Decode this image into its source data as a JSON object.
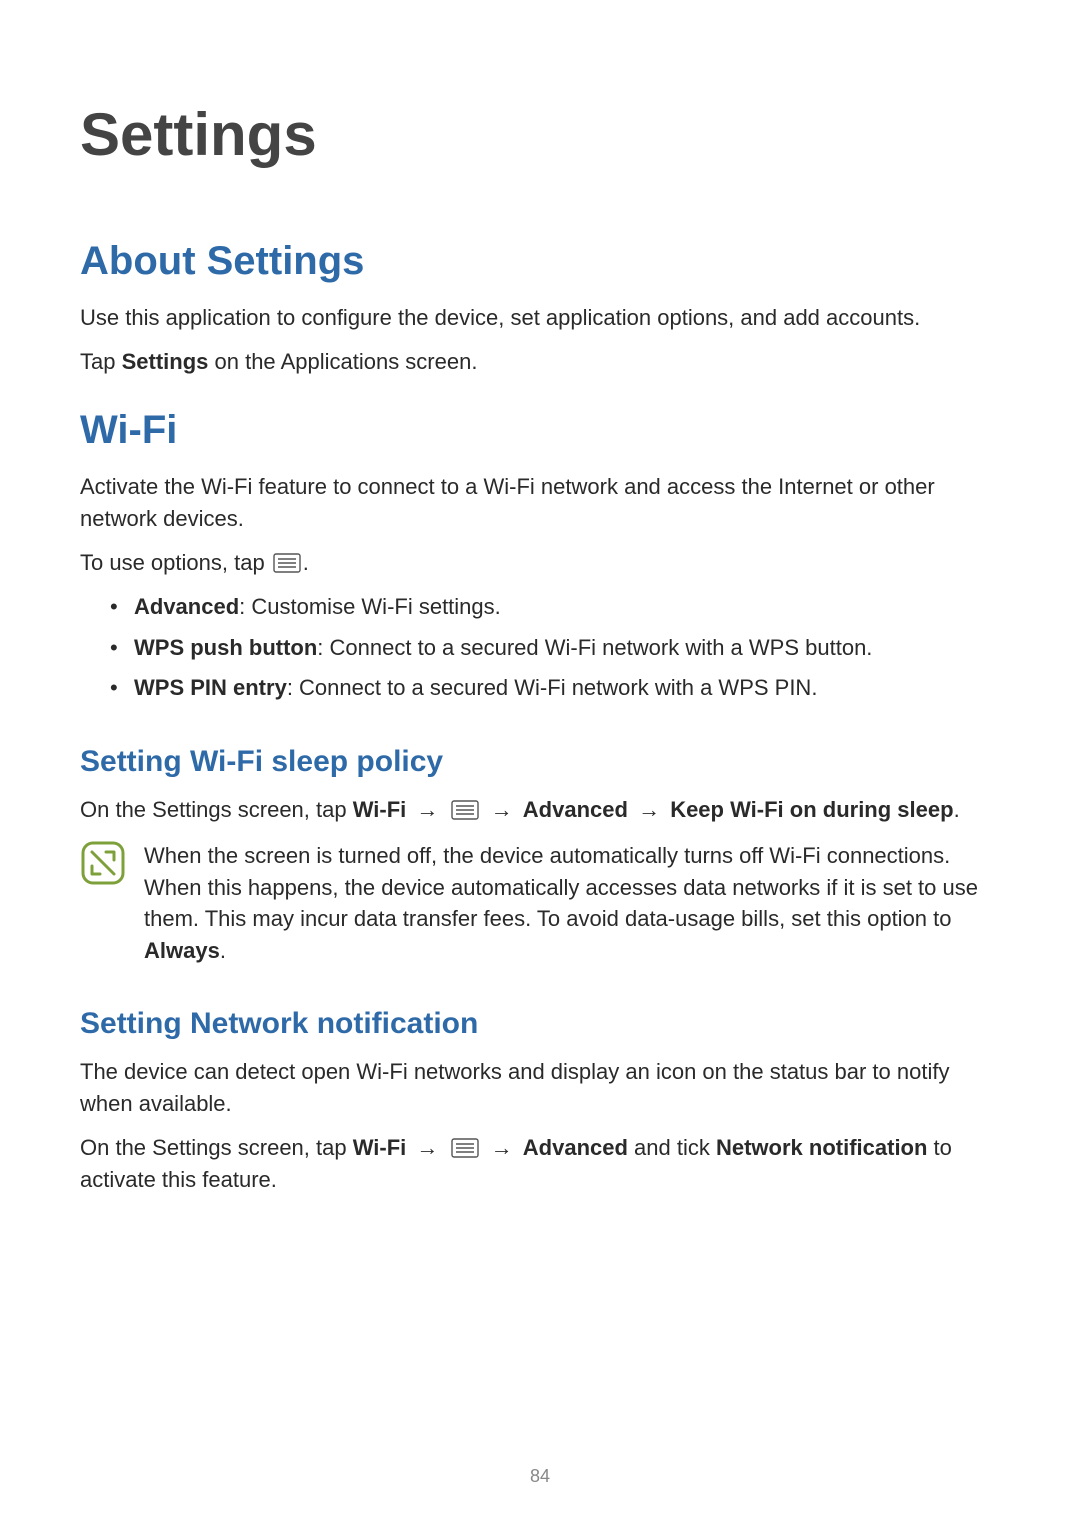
{
  "chapter_title": "Settings",
  "about": {
    "heading": "About Settings",
    "p1": "Use this application to configure the device, set application options, and add accounts.",
    "p2_pre": "Tap ",
    "p2_bold": "Settings",
    "p2_post": " on the Applications screen."
  },
  "wifi": {
    "heading": "Wi-Fi",
    "p1": "Activate the Wi-Fi feature to connect to a Wi-Fi network and access the Internet or other network devices.",
    "p2_pre": "To use options, tap ",
    "p2_post": ".",
    "bullets": {
      "b1": {
        "label": "Advanced",
        "desc": ": Customise Wi-Fi settings."
      },
      "b2": {
        "label": "WPS push button",
        "desc": ": Connect to a secured Wi-Fi network with a WPS button."
      },
      "b3": {
        "label": "WPS PIN entry",
        "desc": ": Connect to a secured Wi-Fi network with a WPS PIN."
      }
    }
  },
  "sleep": {
    "heading": "Setting Wi-Fi sleep policy",
    "pre": "On the Settings screen, tap ",
    "wifi": "Wi-Fi",
    "arrow": "→",
    "advanced": "Advanced",
    "keep": "Keep Wi-Fi on during sleep",
    "period": ".",
    "note_pre": "When the screen is turned off, the device automatically turns off Wi-Fi connections. When this happens, the device automatically accesses data networks if it is set to use them. This may incur data transfer fees. To avoid data-usage bills, set this option to ",
    "note_bold": "Always",
    "note_post": "."
  },
  "network_notif": {
    "heading": "Setting Network notification",
    "p1": "The device can detect open Wi-Fi networks and display an icon on the status bar to notify when available.",
    "p2_pre": "On the Settings screen, tap ",
    "wifi": "Wi-Fi",
    "arrow": "→",
    "advanced": "Advanced",
    "mid": " and tick ",
    "nn": "Network notification",
    "post": " to activate this feature."
  },
  "page_number": "84"
}
